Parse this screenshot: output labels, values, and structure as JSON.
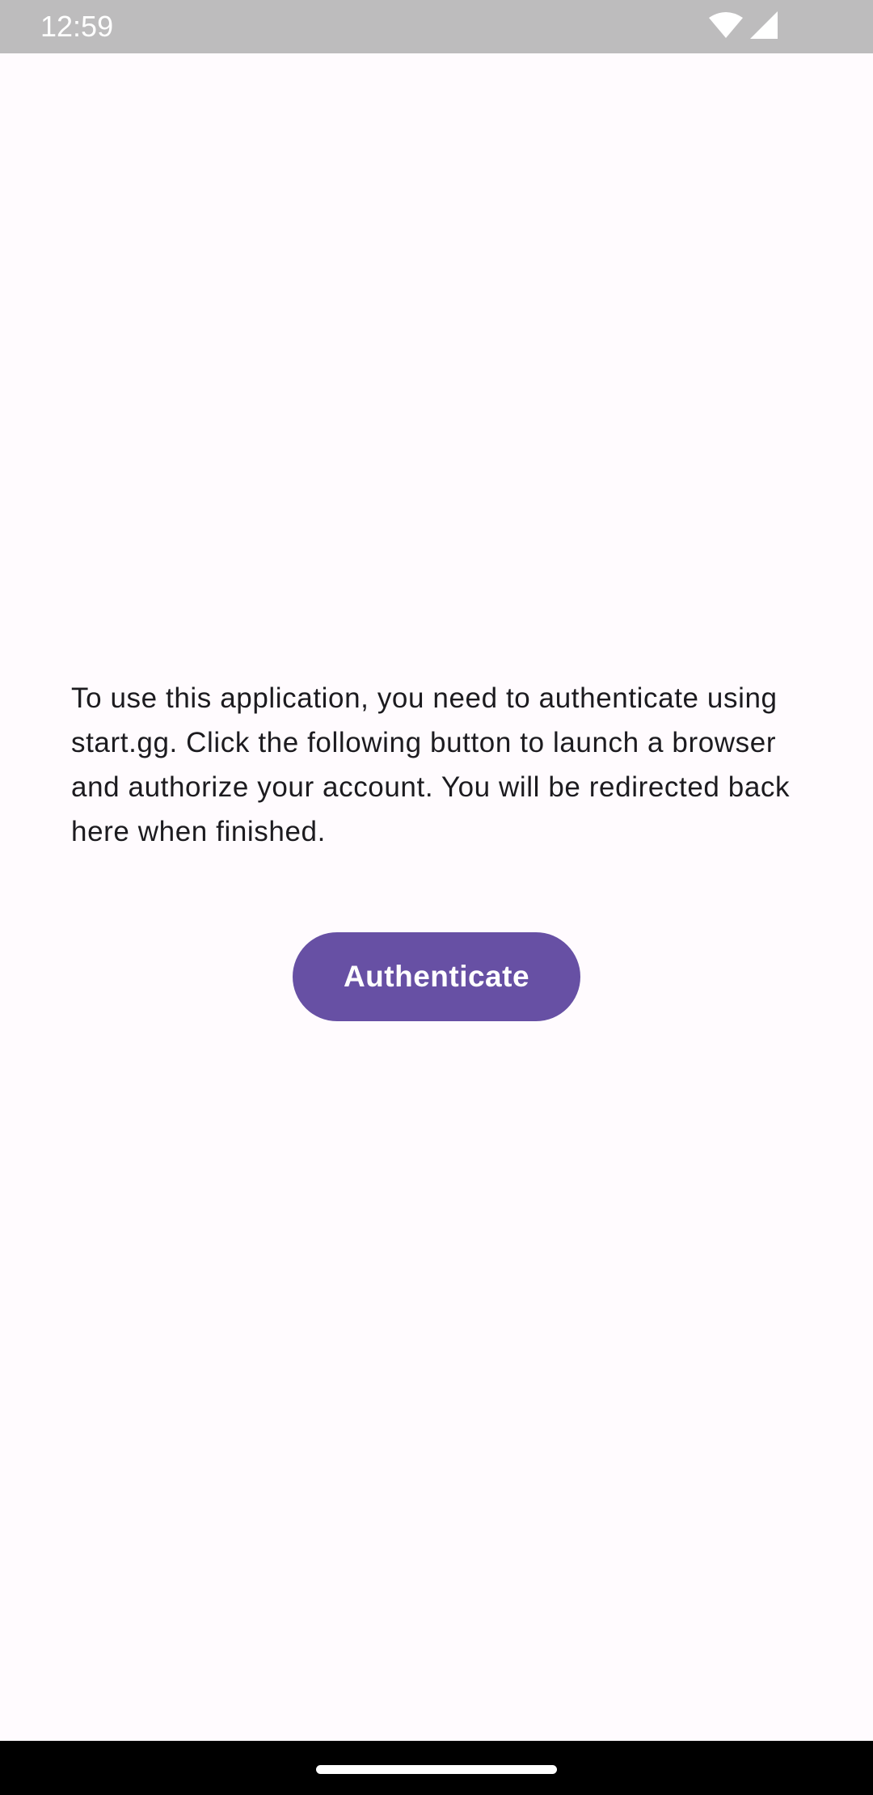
{
  "status_bar": {
    "time": "12:59",
    "icons": [
      "wifi-icon",
      "cellular-signal-icon"
    ]
  },
  "auth_screen": {
    "message": "To use this application, you need to authenticate using start.gg. Click the following button to launch a browser and authorize your account. You will be redirected back here when finished.",
    "button_label": "Authenticate"
  },
  "colors": {
    "background": "#FFFBFE",
    "status_bar": "#BDBCBD",
    "button": "#6750A4",
    "button_text": "#FFFFFF",
    "body_text": "#1C1B1F",
    "nav_bar": "#000000"
  }
}
